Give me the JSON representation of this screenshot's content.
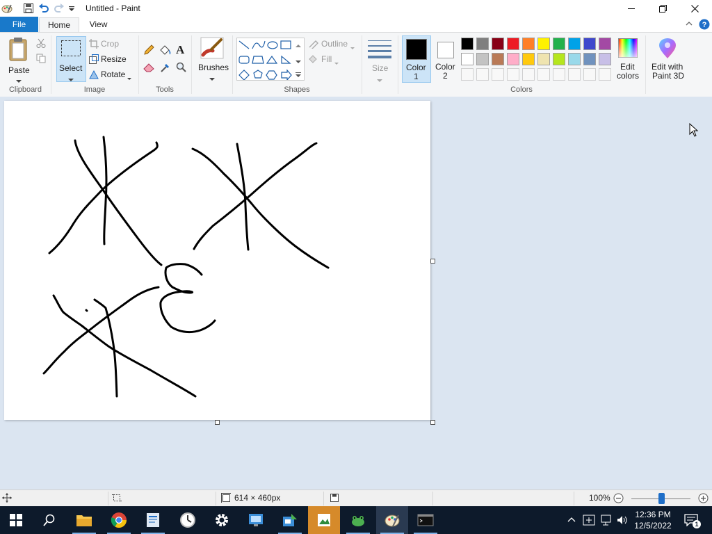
{
  "window": {
    "title": "Untitled - Paint"
  },
  "tabs": {
    "file": "File",
    "home": "Home",
    "view": "View"
  },
  "ribbon": {
    "clipboard": {
      "paste": "Paste",
      "group": "Clipboard"
    },
    "image": {
      "select": "Select",
      "crop": "Crop",
      "resize": "Resize",
      "rotate": "Rotate",
      "group": "Image"
    },
    "tools": {
      "group": "Tools"
    },
    "brushes": {
      "label": "Brushes"
    },
    "shapes": {
      "outline": "Outline",
      "fill": "Fill",
      "group": "Shapes"
    },
    "size": {
      "label": "Size"
    },
    "colors": {
      "color1_line1": "Color",
      "color1_line2": "1",
      "color2_line1": "Color",
      "color2_line2": "2",
      "edit_line1": "Edit",
      "edit_line2": "colors",
      "group": "Colors",
      "color1": "#000000",
      "color2": "#ffffff",
      "row1": [
        "#000000",
        "#7f7f7f",
        "#880015",
        "#ed1c24",
        "#ff7f27",
        "#fff200",
        "#22b14c",
        "#00a2e8",
        "#3f48cc",
        "#a349a4"
      ],
      "row2": [
        "#ffffff",
        "#c3c3c3",
        "#b97a57",
        "#ffaec9",
        "#ffc90e",
        "#efe4b0",
        "#b5e61d",
        "#99d9ea",
        "#7092be",
        "#c8bfe7"
      ]
    },
    "paint3d": {
      "line1": "Edit with",
      "line2": "Paint 3D"
    }
  },
  "status": {
    "canvas_size": "614 × 460px",
    "zoom": "100%",
    "zoom_level": 0.5
  },
  "taskbar": {
    "time": "12:36 PM",
    "date": "12/5/2022",
    "notification_count": "1"
  }
}
